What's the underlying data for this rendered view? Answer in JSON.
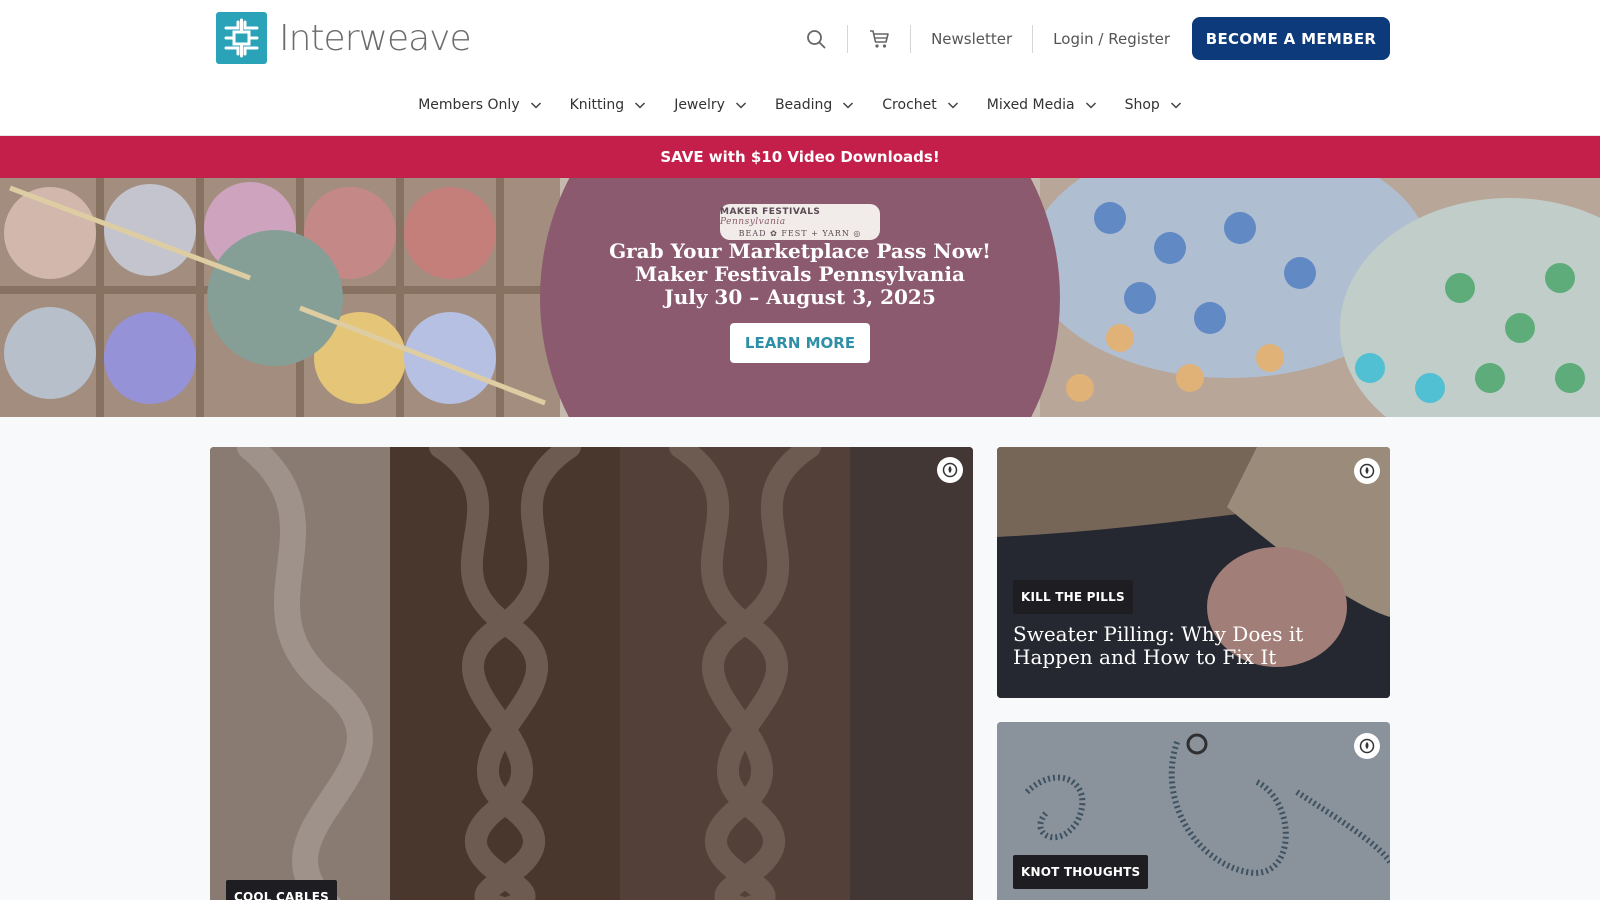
{
  "brand": {
    "name": "Interweave",
    "logo_icon": "interweave-knot-logo",
    "logo_color": "#2aa3b8"
  },
  "utility": {
    "search_icon": "search-icon",
    "cart_icon": "cart-icon",
    "newsletter": "Newsletter",
    "login": "Login / Register",
    "cta": "BECOME A MEMBER",
    "cta_color": "#0d3a7a"
  },
  "nav": {
    "items": [
      {
        "label": "Members Only"
      },
      {
        "label": "Knitting"
      },
      {
        "label": "Jewelry"
      },
      {
        "label": "Beading"
      },
      {
        "label": "Crochet"
      },
      {
        "label": "Mixed Media"
      },
      {
        "label": "Shop"
      }
    ]
  },
  "promo": {
    "text": "SAVE with $10 Video Downloads!",
    "color": "#c41e4a"
  },
  "hero": {
    "badge_top": "MAKER FESTIVALS",
    "badge_script": "Pennsylvania",
    "badge_bottom": "BEAD ✿ FEST + YARN ◎",
    "line1": "Grab Your Marketplace Pass Now!",
    "line2": "Maker Festivals Pennsylvania",
    "line3": "July 30 – August 3, 2025",
    "button": "LEARN MORE"
  },
  "articles": {
    "main": {
      "tag": "COOL CABLES"
    },
    "side1": {
      "tag": "KILL THE PILLS",
      "title": "Sweater Pilling: Why Does it Happen and How to Fix It"
    },
    "side2": {
      "tag": "KNOT THOUGHTS"
    }
  }
}
